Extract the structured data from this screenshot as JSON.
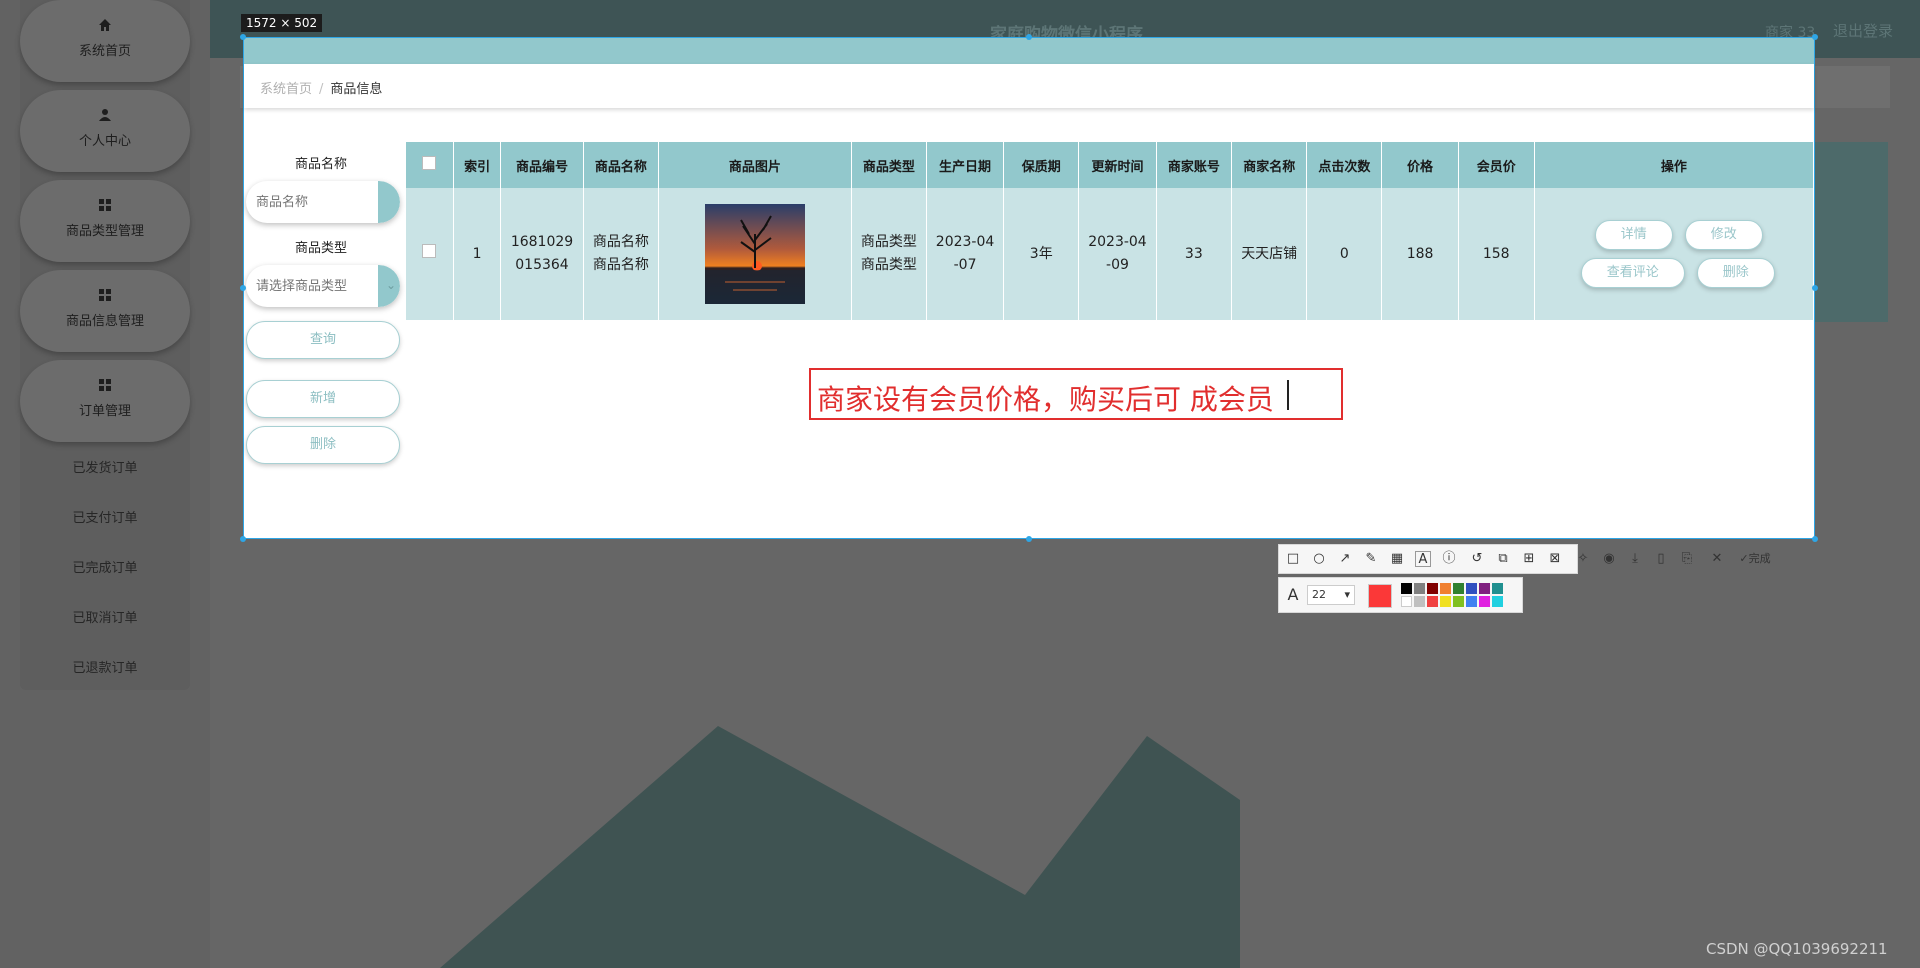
{
  "sidebar": {
    "menu": [
      {
        "label": "系统首页",
        "icon": "home-icon"
      },
      {
        "label": "个人中心",
        "icon": "user-icon"
      },
      {
        "label": "商品类型管理",
        "icon": "grid-icon"
      },
      {
        "label": "商品信息管理",
        "icon": "grid-icon"
      },
      {
        "label": "订单管理",
        "icon": "grid-icon"
      }
    ],
    "submenu": [
      "已发货订单",
      "已支付订单",
      "已完成订单",
      "已取消订单",
      "已退款订单"
    ]
  },
  "header": {
    "title": "家庭购物微信小程序",
    "user": "商家 33",
    "logout": "退出登录"
  },
  "capture": {
    "size_label": "1572 × 502"
  },
  "breadcrumb": {
    "home": "系统首页",
    "separator": "/",
    "current": "商品信息"
  },
  "search": {
    "name_label": "商品名称",
    "name_placeholder": "商品名称",
    "type_label": "商品类型",
    "type_placeholder": "请选择商品类型",
    "query_button": "查询",
    "add_button": "新增",
    "delete_button": "删除"
  },
  "table": {
    "headers": [
      "索引",
      "商品编号",
      "商品名称",
      "商品图片",
      "商品类型",
      "生产日期",
      "保质期",
      "更新时间",
      "商家账号",
      "商家名称",
      "点击次数",
      "价格",
      "会员价",
      "操作"
    ],
    "rows": [
      {
        "index": "1",
        "code": "1681029015364",
        "code_line1": "1681029",
        "code_line2": "015364",
        "name_line1": "商品名称",
        "name_line2": "商品名称",
        "type_line1": "商品类型",
        "type_line2": "商品类型",
        "prod_date_line1": "2023-04",
        "prod_date_line2": "-07",
        "shelf_life": "3年",
        "update_line1": "2023-04",
        "update_line2": "-09",
        "merchant_account": "33",
        "merchant_name": "天天店铺",
        "clicks": "0",
        "price": "188",
        "member_price": "158",
        "actions": {
          "detail": "详情",
          "edit": "修改",
          "reviews": "查看评论",
          "delete": "删除"
        }
      }
    ]
  },
  "annotation": {
    "text": "商家设有会员价格，购买后可 成会员",
    "color": "#e12e2e"
  },
  "toolbar": {
    "font_size": "22",
    "done_label": "完成",
    "current_color": "#fb3838",
    "palette_top": [
      "#000000",
      "#808080",
      "#800000",
      "#f08030",
      "#308030",
      "#3050c0",
      "#802080",
      "#209090"
    ],
    "palette_bottom": [
      "#ffffff",
      "#c0c0c0",
      "#f04040",
      "#f0e020",
      "#80c020",
      "#4080f0",
      "#e020e0",
      "#20d0e0"
    ]
  },
  "watermark": "CSDN @QQ1039692211"
}
